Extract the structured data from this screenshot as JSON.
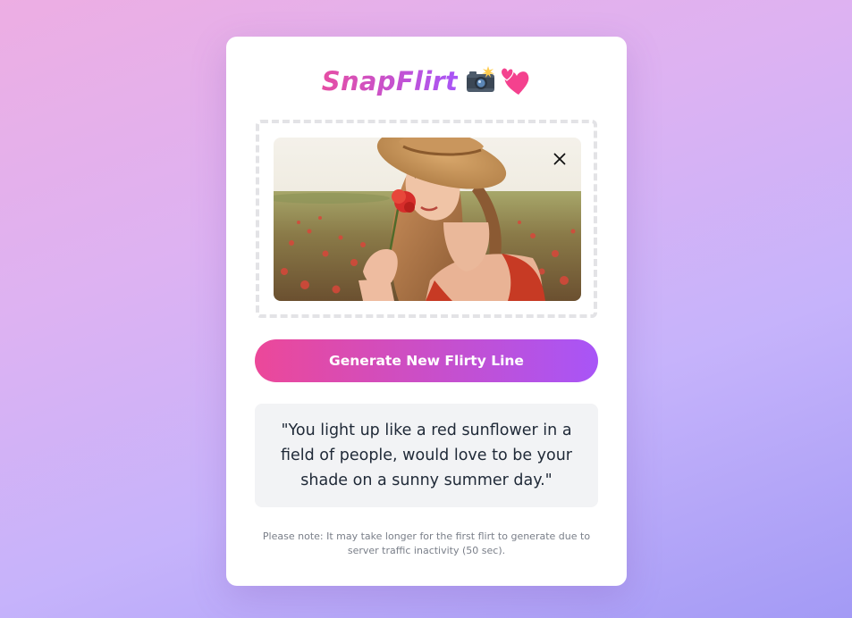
{
  "app": {
    "title": "SnapFlirt",
    "title_emojis": [
      "camera-with-flash",
      "two-hearts"
    ]
  },
  "upload": {
    "image_alt": "Woman in straw hat smelling a red poppy in a field",
    "remove_icon": "close-icon"
  },
  "actions": {
    "generate_label": "Generate New Flirty Line"
  },
  "result": {
    "quote": "\"You light up like a red sunflower in a field of people, would love to be your shade on a sunny summer day.\""
  },
  "footer": {
    "note": "Please note: It may take longer for the first flirt to generate due to server traffic inactivity (50 sec)."
  },
  "colors": {
    "accent_pink": "#ec4899",
    "accent_purple": "#a855f7",
    "text_dark": "#1f2937",
    "note_gray": "#7a7f89",
    "quote_bg": "#f2f3f5"
  }
}
